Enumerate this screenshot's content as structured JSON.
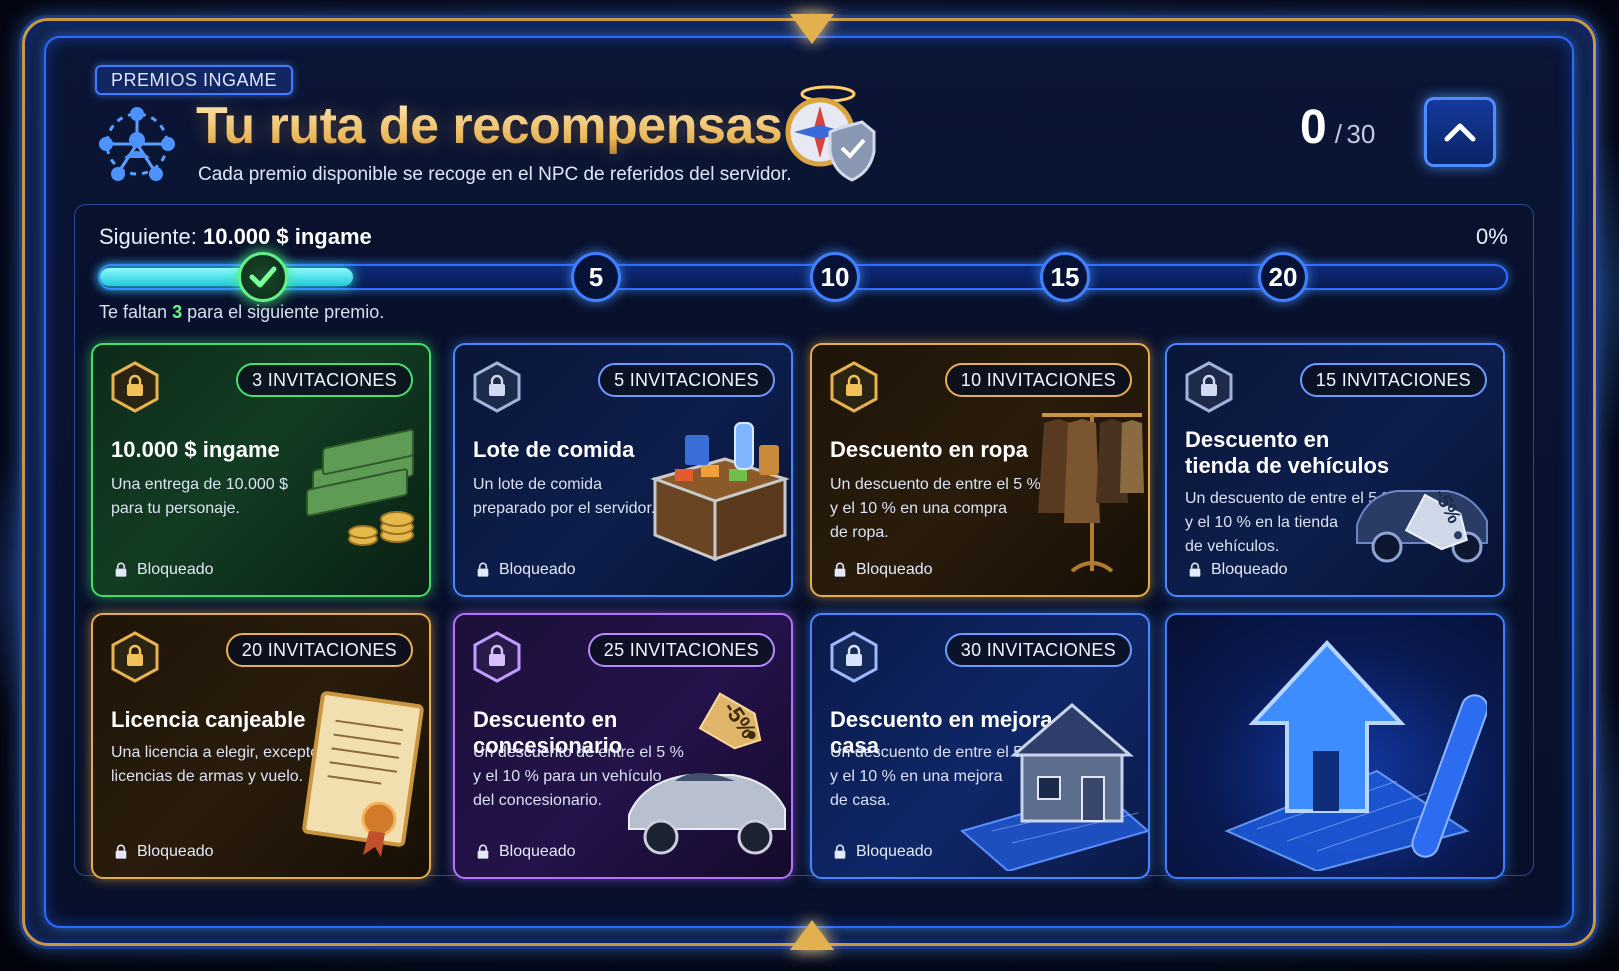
{
  "header": {
    "badge": "PREMIOS INGAME",
    "title": "Tu ruta de recompensas",
    "subtitle": "Cada premio disponible se recoge en el NPC de referidos del servidor.",
    "counter": {
      "current": "0",
      "separator": "/",
      "max": "30"
    },
    "collapse_icon": "chevron-up-icon"
  },
  "progress": {
    "next_prefix": "Siguiente:",
    "next_reward": "10.000 $ ingame",
    "percent_label": "0%",
    "fill_fraction": 0.18,
    "milestones": [
      "5",
      "10",
      "15",
      "20"
    ],
    "hint_prefix": "Te faltan",
    "hint_count": "3",
    "hint_suffix": "para el siguiente premio."
  },
  "cards": [
    {
      "requirement": "3 INVITACIONES",
      "title": "10.000 $ ingame",
      "desc": [
        "Una entrega de 10.000 $",
        "para tu personaje."
      ],
      "status": "Bloqueado",
      "theme": "green",
      "icon": "money-stack-icon"
    },
    {
      "requirement": "5 INVITACIONES",
      "title": "Lote de comida",
      "desc": [
        "Un lote de comida",
        "preparado por el servidor."
      ],
      "status": "Bloqueado",
      "theme": "blue",
      "icon": "food-crate-icon"
    },
    {
      "requirement": "10 INVITACIONES",
      "title": "Descuento en ropa",
      "desc": [
        "Un descuento de entre el 5 %",
        "y el 10 % en una compra",
        "de ropa."
      ],
      "status": "Bloqueado",
      "theme": "gold",
      "icon": "clothes-rack-icon"
    },
    {
      "requirement": "15 INVITACIONES",
      "title": "Descuento en tienda de vehículos",
      "desc": [
        "Un descuento de entre el 5 %",
        "y el 10 % en la tienda",
        "de vehículos."
      ],
      "status": "Bloqueado",
      "theme": "blue",
      "icon": "car-tag-icon",
      "tag": "-5%"
    },
    {
      "requirement": "20 INVITACIONES",
      "title": "Licencia canjeable",
      "desc": [
        "Una licencia a elegir, excepto",
        "licencias de armas y vuelo."
      ],
      "status": "Bloqueado",
      "theme": "gold",
      "icon": "certificate-icon"
    },
    {
      "requirement": "25 INVITACIONES",
      "title": "Descuento en concesionario",
      "desc": [
        "Un descuento de entre el 5 %",
        "y el 10 % para un vehículo",
        "del concesionario."
      ],
      "status": "Bloqueado",
      "theme": "purple",
      "icon": "sports-car-icon",
      "tag": "-5%"
    },
    {
      "requirement": "30 INVITACIONES",
      "title": "Descuento en mejora de casa",
      "desc": [
        "Un descuento de entre el 5 %",
        "y el 10 % en una mejora",
        "de casa."
      ],
      "status": "Bloqueado",
      "theme": "blue2",
      "icon": "house-blueprint-icon"
    },
    {
      "icon": "upgrade-arrow-blueprint-icon",
      "theme": "feature"
    }
  ],
  "colors": {
    "gold": "#e9b75b",
    "accent_blue": "#3f80ff",
    "progress_cyan": "#34e6f0",
    "success_green": "#47e070",
    "purple": "#b473ff"
  }
}
